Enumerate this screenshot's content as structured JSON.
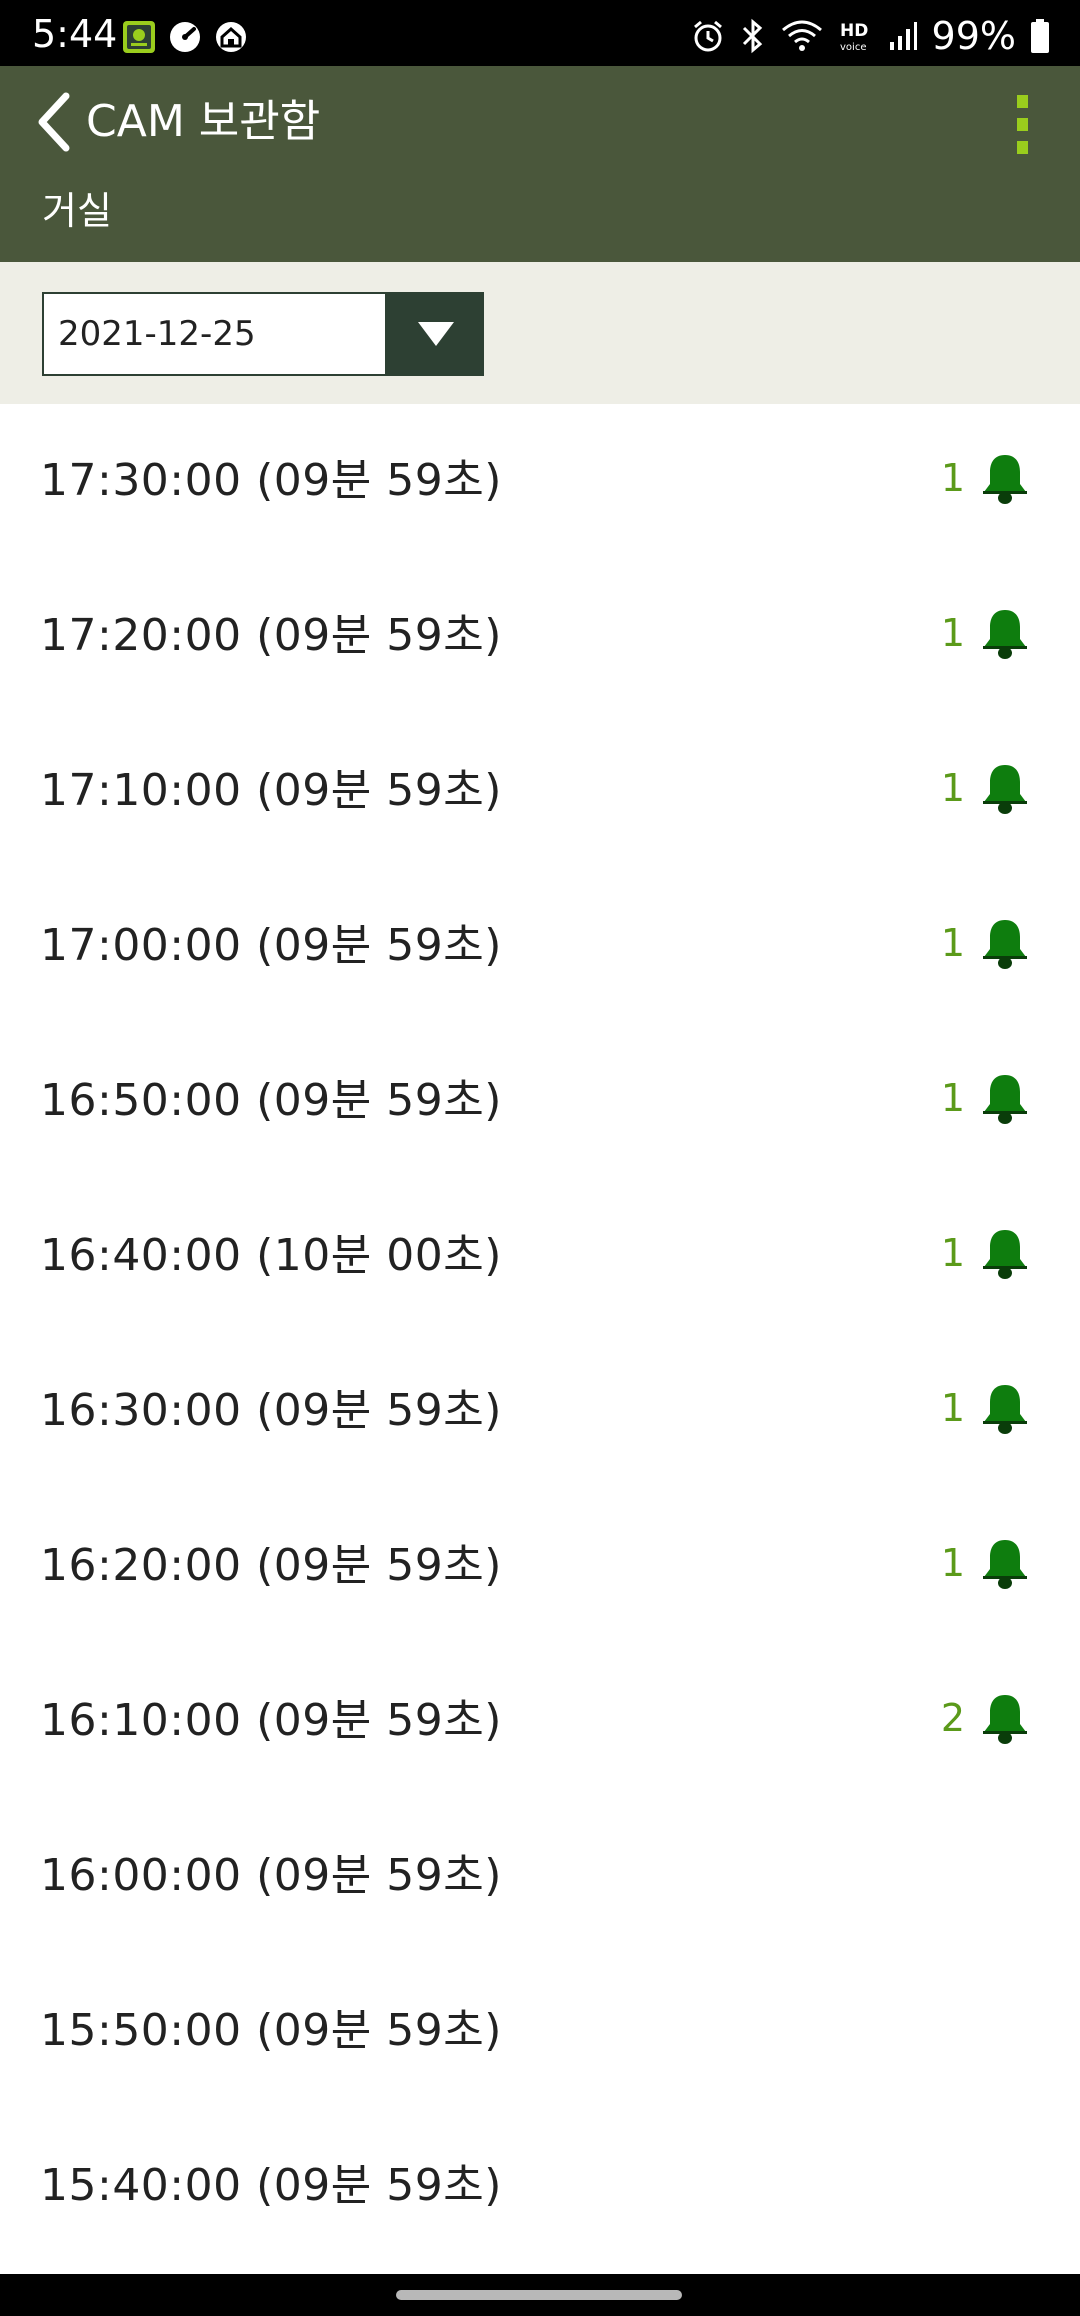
{
  "status_bar": {
    "time": "5:44",
    "battery": "99%",
    "icons": [
      "app-notification-icon",
      "speed-icon",
      "home-icon",
      "alarm-icon",
      "bluetooth-icon",
      "wifi-icon",
      "hd-voice-icon",
      "signal-icon",
      "battery-icon"
    ]
  },
  "header": {
    "title": "CAM 보관함",
    "subtitle": "거실",
    "menu_accent_color": "#9acd1d",
    "bar_color": "#4a573b"
  },
  "date_picker": {
    "value": "2021-12-25"
  },
  "recordings": [
    {
      "time": "17:30:00 (09분 59초)",
      "count": "1"
    },
    {
      "time": "17:20:00 (09분 59초)",
      "count": "1"
    },
    {
      "time": "17:10:00 (09분 59초)",
      "count": "1"
    },
    {
      "time": "17:00:00 (09분 59초)",
      "count": "1"
    },
    {
      "time": "16:50:00 (09분 59초)",
      "count": "1"
    },
    {
      "time": "16:40:00 (10분 00초)",
      "count": "1"
    },
    {
      "time": "16:30:00 (09분 59초)",
      "count": "1"
    },
    {
      "time": "16:20:00 (09분 59초)",
      "count": "1"
    },
    {
      "time": "16:10:00 (09분 59초)",
      "count": "2"
    },
    {
      "time": "16:00:00 (09분 59초)",
      "count": ""
    },
    {
      "time": "15:50:00 (09분 59초)",
      "count": ""
    },
    {
      "time": "15:40:00 (09분 59초)",
      "count": ""
    }
  ],
  "colors": {
    "bell": "#0e7d0e",
    "count_text": "#5b9a1a",
    "date_band": "#eeeee6"
  }
}
